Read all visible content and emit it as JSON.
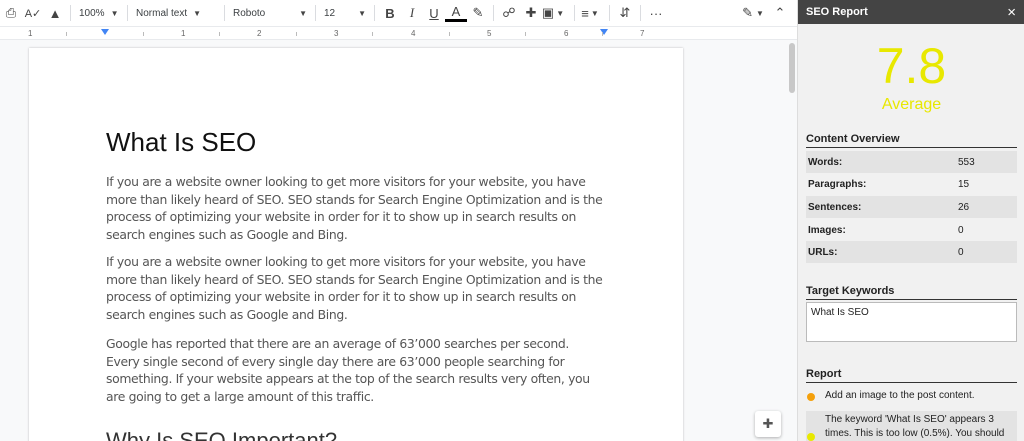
{
  "toolbar": {
    "zoom": "100%",
    "style": "Normal text",
    "font": "Roboto",
    "size": "12",
    "more": "···"
  },
  "ruler": {
    "numbers": [
      "1",
      "1",
      "2",
      "3",
      "4",
      "5",
      "6",
      "7"
    ]
  },
  "document": {
    "title": "What Is SEO",
    "paragraphs": [
      "If you are a website owner looking to get more visitors for your website, you have more than likely heard of SEO. SEO stands for Search Engine Optimization and is the process of optimizing your website in order for it to show up in search results on search engines such as Google and Bing.",
      "If you are a website owner looking to get more visitors for your website, you have more than likely heard of SEO. SEO stands for Search Engine Optimization and is the process of optimizing your website in order for it to show up in search results on search engines such as Google and Bing.",
      "Google has reported that there are an average of 63’000 searches per second. Every single second of every single day there are 63’000 people searching for something. If your website appears at the top of the search results very often, you are going to get a large amount of this traffic."
    ],
    "heading2": "Why Is SEO Important?"
  },
  "sidebar": {
    "title": "SEO Report",
    "close": "×",
    "score": "7.8",
    "score_label": "Average",
    "content_overview": {
      "heading": "Content Overview",
      "rows": [
        {
          "label": "Words:",
          "value": "553"
        },
        {
          "label": "Paragraphs:",
          "value": "15"
        },
        {
          "label": "Sentences:",
          "value": "26"
        },
        {
          "label": "Images:",
          "value": "0"
        },
        {
          "label": "URLs:",
          "value": "0"
        }
      ]
    },
    "target_keywords": {
      "heading": "Target Keywords",
      "value": "What Is SEO"
    },
    "report": {
      "heading": "Report",
      "items": [
        {
          "text": "Add an image to the post content.",
          "color": "#f4a00b"
        },
        {
          "text": "The keyword 'What Is SEO' appears 3 times. This is too low (0.5%). You should",
          "color": "#e8e800"
        }
      ]
    }
  },
  "colors": {
    "score": "#e8e800",
    "header_bg": "#444444",
    "accent": "#4285f4"
  }
}
